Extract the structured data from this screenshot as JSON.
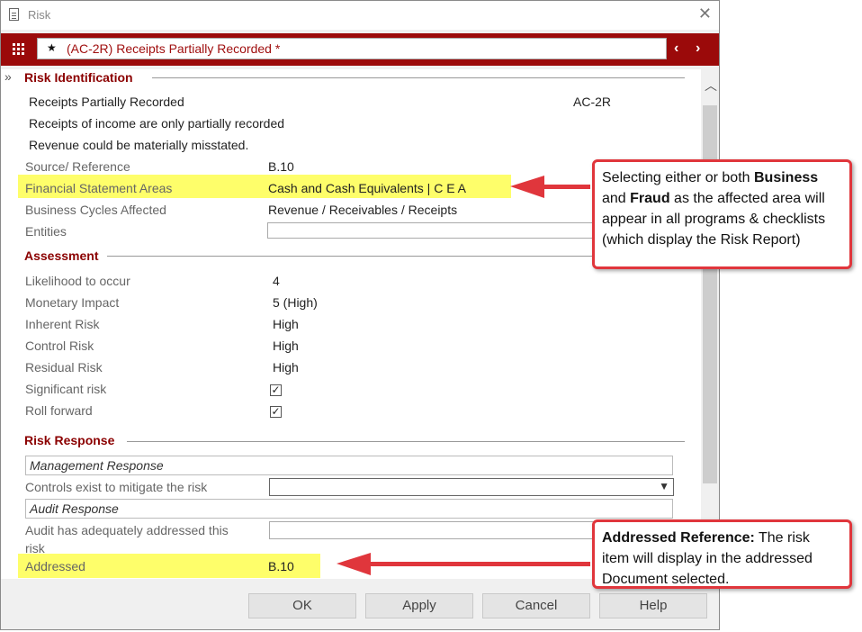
{
  "window": {
    "title": "Risk",
    "record_star": "★",
    "record_name": "(AC-2R)  Receipts Partially Recorded *"
  },
  "identification": {
    "section_title": "Risk Identification",
    "name": "Receipts Partially Recorded",
    "code": "AC-2R",
    "description": "Receipts of income are only partially recorded",
    "consequence": "Revenue could be materially misstated.",
    "source_label": "Source/ Reference",
    "source_value": "B.10",
    "fsa_label": "Financial Statement Areas",
    "fsa_value": "Cash and Cash Equivalents | C E A",
    "cycles_label": "Business Cycles Affected",
    "cycles_value": "Revenue / Receivables / Receipts",
    "entities_label": "Entities",
    "entities_value": ""
  },
  "assessment": {
    "section_title": "Assessment",
    "likelihood_label": "Likelihood to occur",
    "likelihood_value": "4",
    "monetary_label": "Monetary Impact",
    "monetary_value": "5 (High)",
    "inherent_label": "Inherent Risk",
    "inherent_value": "High",
    "control_label": "Control Risk",
    "control_value": "High",
    "residual_label": "Residual Risk",
    "residual_value": "High",
    "significant_label": "Significant risk",
    "significant_checked": true,
    "rollforward_label": "Roll forward",
    "rollforward_checked": true,
    "check_glyph": "✓"
  },
  "response": {
    "section_title": "Risk Response",
    "management_header": "Management Response",
    "controls_label": "Controls exist to mitigate the risk",
    "controls_value": "",
    "audit_header": "Audit Response",
    "audit_label_line1": "Audit has adequately addressed this",
    "audit_label_line2": "risk",
    "audit_value": "",
    "addressed_label": "Addressed",
    "addressed_value": "B.10"
  },
  "buttons": {
    "ok": "OK",
    "apply": "Apply",
    "cancel": "Cancel",
    "help": "Help"
  },
  "callouts": {
    "top": {
      "t1": "Selecting either or both ",
      "b1": "Business",
      "t2": "and ",
      "b2": "Fraud",
      "t3": " as the affected area will",
      "t4": "appear in all programs & checklists",
      "t5": "(which display the Risk Report)"
    },
    "bottom": {
      "b1": "Addressed Reference:",
      "t1": " The risk",
      "t2": "item will display in the addressed",
      "t3": "Document selected."
    }
  },
  "colors": {
    "accent": "#9b0a0a",
    "highlight": "#fefe6a",
    "callout_border": "#e0363c"
  }
}
